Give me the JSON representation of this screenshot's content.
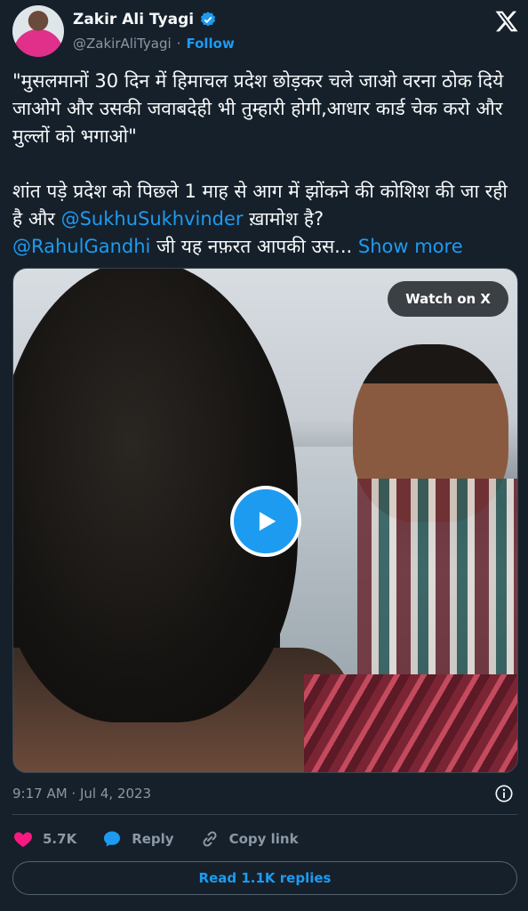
{
  "author": {
    "name": "Zakir Ali Tyagi",
    "handle": "@ZakirAliTyagi",
    "separator": "·",
    "follow_label": "Follow",
    "verified": true
  },
  "tweet": {
    "line1": "\"मुसलमानों 30 दिन में हिमाचल प्रदेश छोड़कर चले जाओ वरना ठोक दिये जाओगे और उसकी जवाबदेही भी तुम्हारी होगी,आधार कार्ड चेक करो और मुल्लों को भगाओ\"",
    "line2_a": "शांत पड़े प्रदेश को पिछले 1 माह से आग में झोंकने की कोशिश की जा रही है और ",
    "mention1": "@SukhuSukhvinder",
    "line2_b": " ख़ामोश है?",
    "mention2": "@RahulGandhi",
    "line3": " जी यह नफ़रत आपकी उस... ",
    "show_more": "Show more"
  },
  "media": {
    "watch_label": "Watch on X",
    "play_icon": "play-icon"
  },
  "meta": {
    "timestamp": "9:17 AM · Jul 4, 2023"
  },
  "actions": {
    "likes": "5.7K",
    "reply_label": "Reply",
    "copy_label": "Copy link"
  },
  "read_replies": "Read 1.1K replies",
  "colors": {
    "background": "#15202b",
    "accent": "#1d9bf0",
    "like": "#f91880",
    "muted": "#8b98a5"
  }
}
